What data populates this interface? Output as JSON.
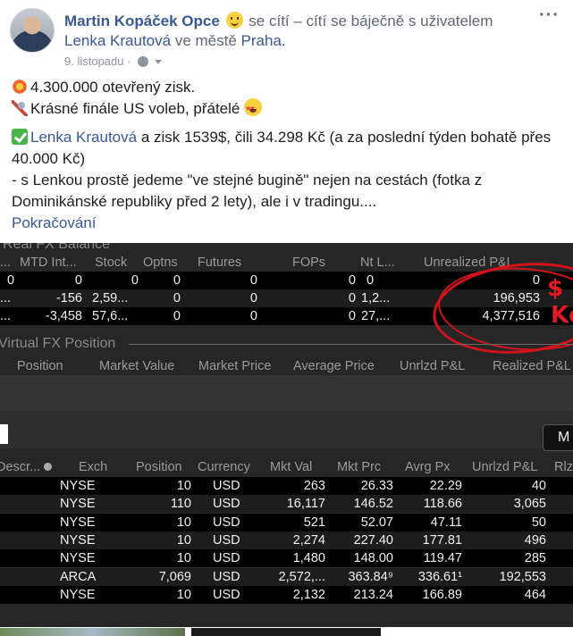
{
  "post": {
    "author": "Martin Kopáček Opce",
    "feeling": "se cítí – cítí se báječně s uživatelem",
    "tagged_user": "Lenka Krautová",
    "location_prefix": "ve městě",
    "location": "Praha.",
    "date": "9. listopadu",
    "more_label": "···",
    "line1": "4.300.000 otevřený zisk.",
    "line2": "Krásné finále US voleb, přátelé",
    "line3_name": "Lenka Krautová",
    "line3_rest": " a zisk 1539$, čili 34.298 Kč (a za poslední týden bohatě přes 40.000 Kč)",
    "line4": "- s Lenkou prostě jedeme \"ve stejné bugině\" nejen na cestách (fotka z Dominikánské republiky před 2 lety), ale i v tradingu....",
    "see_more": "Pokračování"
  },
  "balance": {
    "title": "Real FX Balance",
    "headers": [
      "...",
      "MTD Int...",
      "Stock",
      "Optns",
      "Futures",
      "FOPs",
      "Nt L...",
      "Unrealized P&L"
    ],
    "rows": [
      [
        "0",
        "0",
        "0",
        "0",
        "0",
        "0",
        "0",
        "0"
      ],
      [
        "...",
        "-156",
        "2,59...",
        "0",
        "0",
        "0",
        "1,2...",
        "196,953"
      ],
      [
        "...",
        "-3,458",
        "57,6...",
        "0",
        "0",
        "0",
        "27,...",
        "4,377,516"
      ]
    ],
    "annotation_currency": "$",
    "annotation_czk": "Kč"
  },
  "virtual_fx": {
    "title": "Virtual FX Position",
    "headers": [
      "Position",
      "Market Value",
      "Market Price",
      "Average Price",
      "Unrlzd P&L",
      "Realized P&L"
    ]
  },
  "positions": {
    "more_button": "M",
    "headers": [
      "Descr...",
      "Exch",
      "Position",
      "Currency",
      "Mkt Val",
      "Mkt Prc",
      "Avrg Px",
      "Unrlzd P&L",
      "Rlz"
    ],
    "rows": [
      [
        "NYSE",
        "10",
        "USD",
        "263",
        "26.33",
        "22.29",
        "40"
      ],
      [
        "NYSE",
        "110",
        "USD",
        "16,117",
        "146.52",
        "118.66",
        "3,065"
      ],
      [
        "NYSE",
        "10",
        "USD",
        "521",
        "52.07",
        "47.11",
        "50"
      ],
      [
        "NYSE",
        "10",
        "USD",
        "2,274",
        "227.40",
        "177.81",
        "496"
      ],
      [
        "NYSE",
        "10",
        "USD",
        "1,480",
        "148.00",
        "119.47",
        "285"
      ],
      [
        "ARCA",
        "7,069",
        "USD",
        "2,572,...",
        "363.84⁹",
        "336.61¹",
        "192,553"
      ],
      [
        "NYSE",
        "10",
        "USD",
        "2,132",
        "213.24",
        "166.89",
        "464"
      ]
    ]
  }
}
